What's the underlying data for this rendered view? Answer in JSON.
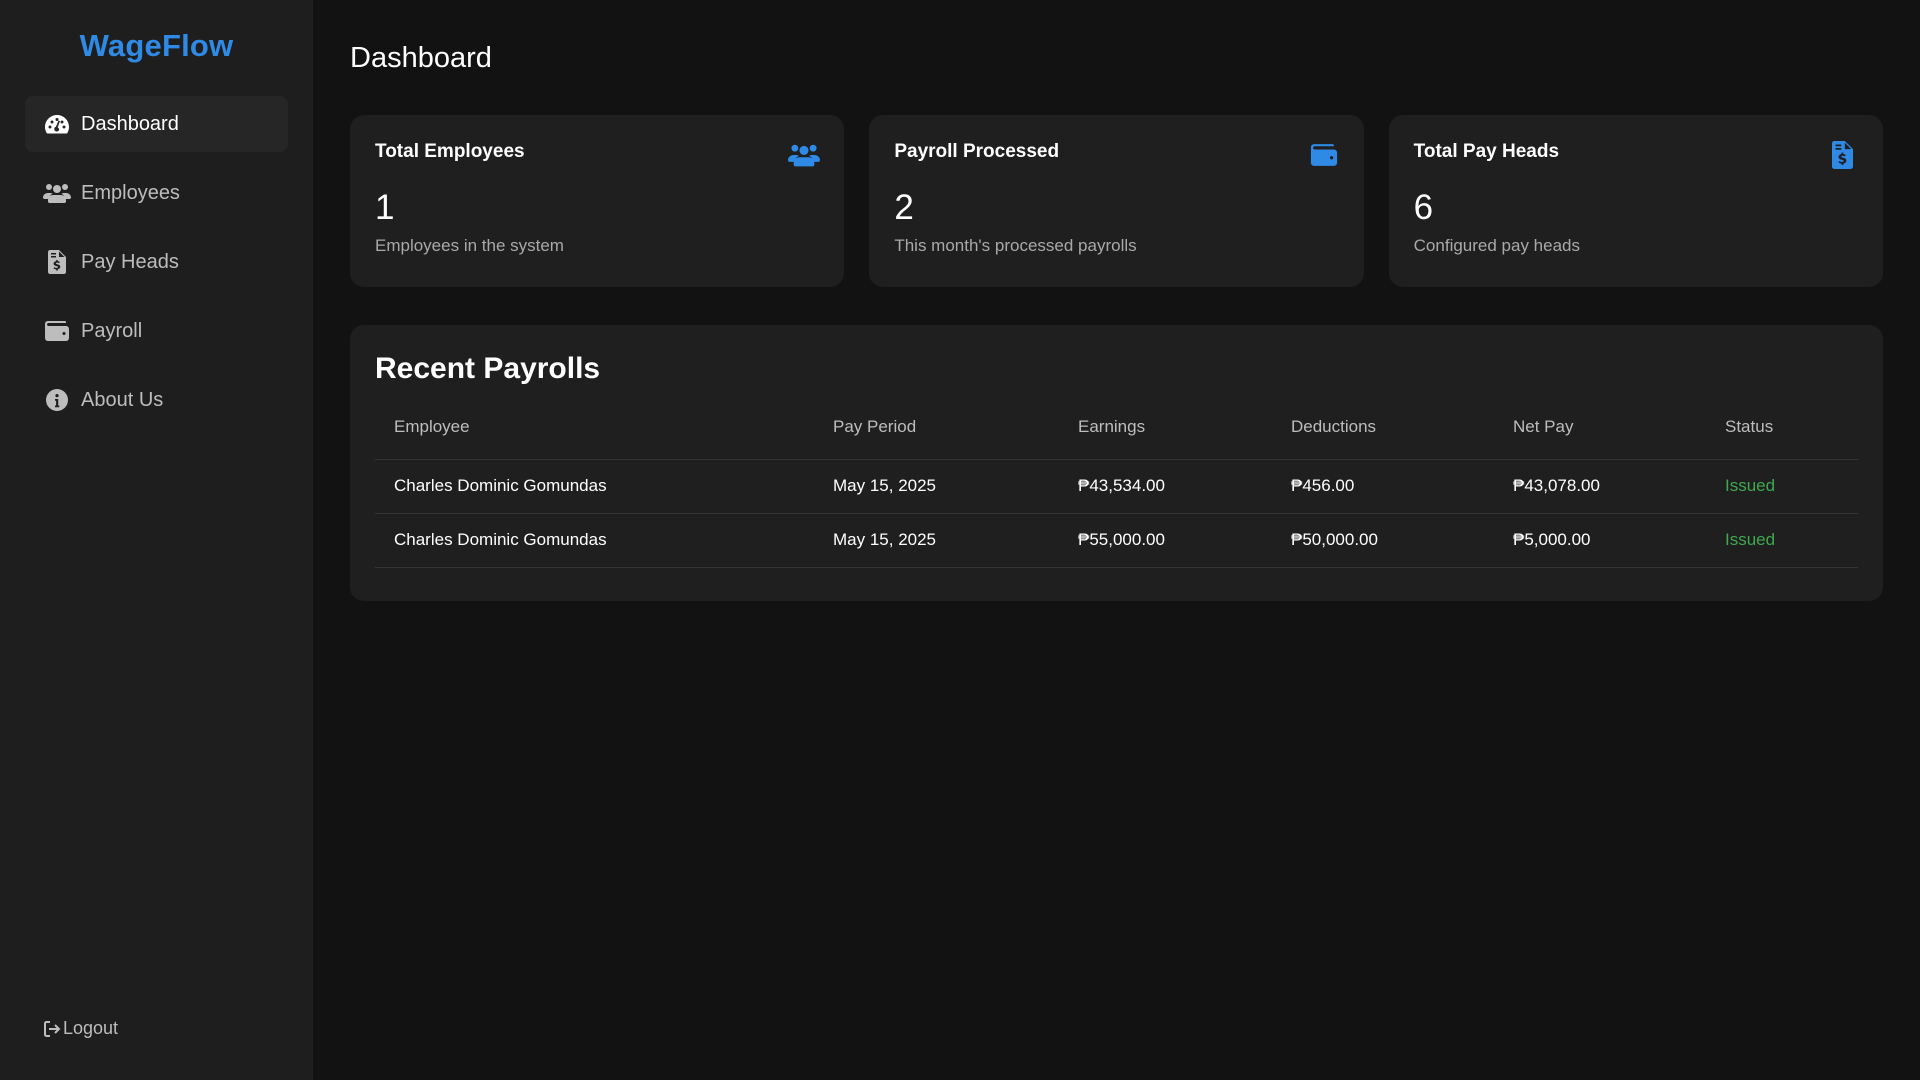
{
  "brand": "WageFlow",
  "sidebar": {
    "items": [
      {
        "label": "Dashboard",
        "icon": "gauge-icon",
        "active": true
      },
      {
        "label": "Employees",
        "icon": "users-icon",
        "active": false
      },
      {
        "label": "Pay Heads",
        "icon": "file-invoice-dollar-icon",
        "active": false
      },
      {
        "label": "Payroll",
        "icon": "wallet-icon",
        "active": false
      },
      {
        "label": "About Us",
        "icon": "info-circle-icon",
        "active": false
      }
    ],
    "logout_label": "Logout"
  },
  "page_title": "Dashboard",
  "cards": [
    {
      "title": "Total Employees",
      "value": "1",
      "desc": "Employees in the system",
      "icon": "users-icon"
    },
    {
      "title": "Payroll Processed",
      "value": "2",
      "desc": "This month's processed payrolls",
      "icon": "wallet-icon"
    },
    {
      "title": "Total Pay Heads",
      "value": "6",
      "desc": "Configured pay heads",
      "icon": "file-invoice-dollar-icon"
    }
  ],
  "recent": {
    "title": "Recent Payrolls",
    "columns": [
      "Employee",
      "Pay Period",
      "Earnings",
      "Deductions",
      "Net Pay",
      "Status"
    ],
    "rows": [
      [
        "Charles Dominic Gomundas",
        "May 15, 2025",
        "₱43,534.00",
        "₱456.00",
        "₱43,078.00",
        "Issued"
      ],
      [
        "Charles Dominic Gomundas",
        "May 15, 2025",
        "₱55,000.00",
        "₱50,000.00",
        "₱5,000.00",
        "Issued"
      ]
    ]
  },
  "colors": {
    "accent": "#2f8ae6",
    "status_issued": "#3fa84f",
    "background": "#121212",
    "surface": "#1f1f1f"
  }
}
